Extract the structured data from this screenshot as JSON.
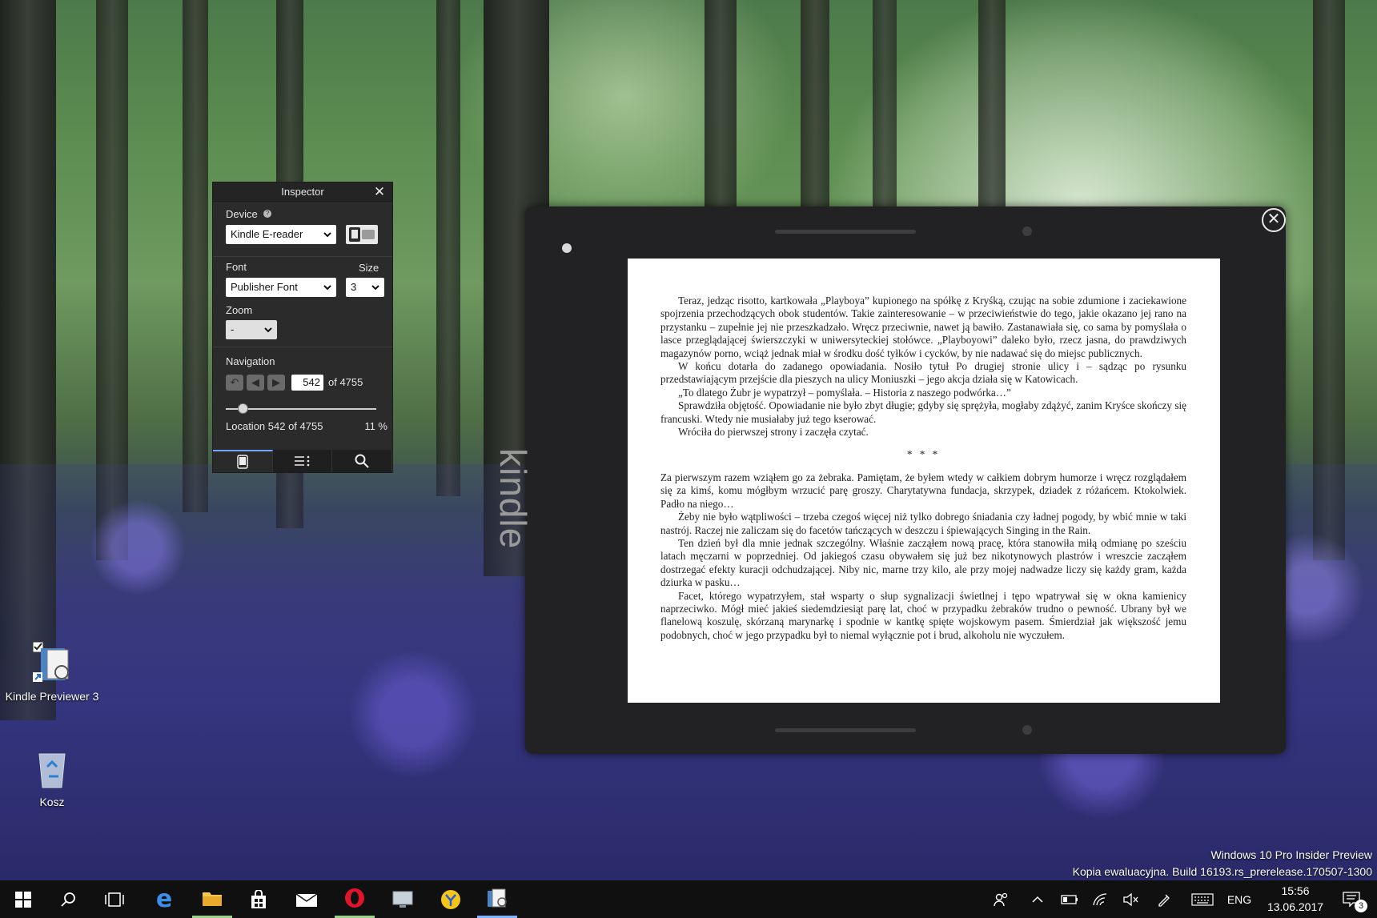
{
  "desktop": {
    "icons": [
      {
        "label": "Kindle Previewer 3"
      },
      {
        "label": "Kosz"
      }
    ],
    "watermark": {
      "line1": "Windows 10 Pro Insider Preview",
      "line2": "Kopia ewaluacyjna. Build 16193.rs_prerelease.170507-1300"
    }
  },
  "inspector": {
    "title": "Inspector",
    "device_label": "Device",
    "device_value": "Kindle E-reader",
    "font_label": "Font",
    "font_value": "Publisher Font",
    "size_label": "Size",
    "size_value": "3",
    "zoom_label": "Zoom",
    "zoom_value": "-",
    "navigation_label": "Navigation",
    "page_value": "542",
    "page_total": "of 4755",
    "location_text": "Location 542 of 4755",
    "percent_text": "11 %",
    "slider_fraction": 0.114
  },
  "kindle": {
    "logo": "kindle",
    "paragraphs": [
      {
        "indent": true,
        "text": "Teraz, jedząc risotto, kartkowała „Playboya” kupionego na spółkę z Kryśką, czując na sobie zdumione i zaciekawione spojrzenia przechodzących obok studentów. Takie zainteresowanie – w przeciwieństwie do tego, jakie okazano jej rano na przystanku – zupełnie jej nie przeszkadzało. Wręcz przeciwnie, nawet ją bawiło. Zastanawiała się, co sama by pomyślała o lasce przeglądającej świerszczyki w uniwersyteckiej stołówce. „Playboyowi” daleko było, rzecz jasna, do prawdziwych magazynów porno, wciąż jednak miał w środku dość tyłków i cycków, by nie nadawać się do miejsc publicznych."
      },
      {
        "indent": true,
        "text": "W końcu dotarła do zadanego opowiadania. Nosiło tytuł Po drugiej stronie ulicy i – sądząc po rysunku przedstawiającym przejście dla pieszych na ulicy Moniuszki – jego akcja działa się w Katowicach."
      },
      {
        "indent": true,
        "text": "„To dlatego Żubr je wypatrzył – pomyślała. – Historia z naszego podwórka…”"
      },
      {
        "indent": true,
        "text": "Sprawdziła objętość. Opowiadanie nie było zbyt długie; gdyby się sprężyła, mogłaby zdążyć, zanim Kryśce skończy się francuski. Wtedy nie musiałaby już tego kserować."
      },
      {
        "indent": true,
        "text": "Wróciła do pierwszej strony i zaczęła czytać."
      }
    ],
    "separator": "* * *",
    "paragraphs2": [
      {
        "indent": false,
        "text": "Za pierwszym razem wziąłem go za żebraka. Pamiętam, że byłem wtedy w całkiem dobrym humorze i wręcz rozglądałem się za kimś, komu mógłbym wrzucić parę groszy. Charytatywna fundacja, skrzypek, dziadek z różańcem. Ktokolwiek. Padło na niego…"
      },
      {
        "indent": true,
        "text": "Żeby nie było wątpliwości – trzeba czegoś więcej niż tylko dobrego śniadania czy ładnej pogody, by wbić mnie w taki nastrój. Raczej nie zaliczam się do facetów tańczących w deszczu i śpiewających Singing in the Rain."
      },
      {
        "indent": true,
        "text": "Ten dzień był dla mnie jednak szczególny. Właśnie zacząłem nową pracę, która stanowiła miłą odmianę po sześciu latach męczarni w poprzedniej. Od jakiegoś czasu obywałem się już bez nikotynowych plastrów i wreszcie zacząłem dostrzegać efekty kuracji odchudzającej. Niby nic, marne trzy kilo, ale przy mojej nadwadze liczy się każdy gram, każda dziurka w pasku…"
      },
      {
        "indent": true,
        "text": "Facet, którego wypatrzyłem, stał wsparty o słup sygnalizacji świetlnej i tępo wpatrywał się w okna kamienicy naprzeciwko. Mógł mieć jakieś siedemdziesiąt parę lat, choć w przypadku żebraków trudno o pewność. Ubrany był we flanelową koszulę, skórzaną marynarkę i spodnie w kantkę spięte wojskowym pasem. Śmierdział jak większość jemu podobnych, choć w jego przypadku był to niemal wyłącznie pot i brud, alkoholu nie wyczułem."
      }
    ]
  },
  "taskbar": {
    "language": "ENG",
    "time": "15:56",
    "date": "13.06.2017",
    "notification_count": "3"
  }
}
